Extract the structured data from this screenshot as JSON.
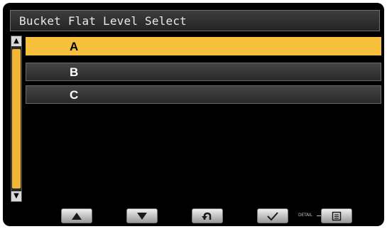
{
  "header": {
    "title": "Bucket Flat Level Select"
  },
  "list": {
    "items": [
      {
        "label": "A",
        "selected": true
      },
      {
        "label": "B",
        "selected": false
      },
      {
        "label": "C",
        "selected": false
      }
    ]
  },
  "scrollbar": {
    "up_icon": "triangle-up",
    "down_icon": "triangle-down"
  },
  "footer": {
    "buttons": [
      {
        "icon": "up-arrow-icon"
      },
      {
        "icon": "down-arrow-icon"
      },
      {
        "icon": "return-icon"
      },
      {
        "icon": "check-icon"
      },
      {
        "icon": "menu-list-icon"
      }
    ],
    "detail_label": "DETAIL"
  },
  "colors": {
    "selected": "#f7c03c",
    "scroll_thumb": "#f2b534",
    "background": "#000000"
  }
}
